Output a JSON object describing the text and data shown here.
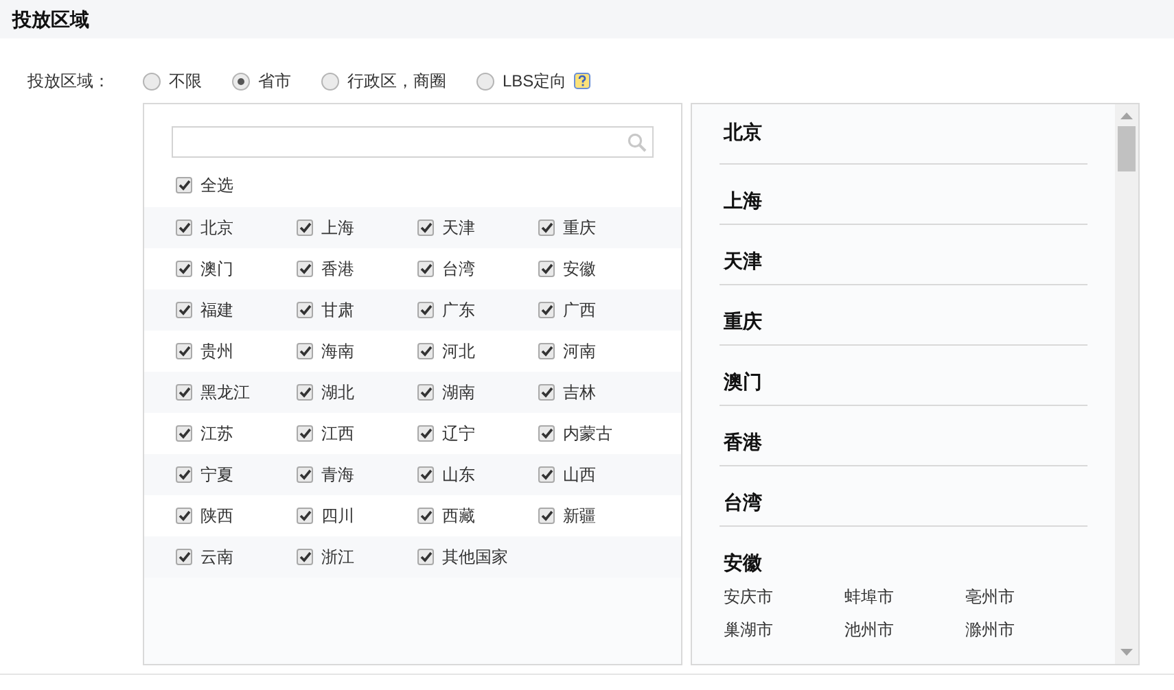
{
  "header": {
    "title": "投放区域"
  },
  "field_label": "投放区域：",
  "options": [
    {
      "label": "不限",
      "selected": false,
      "help": false
    },
    {
      "label": "省市",
      "selected": true,
      "help": false
    },
    {
      "label": "行政区，商圈",
      "selected": false,
      "help": false
    },
    {
      "label": "LBS定向",
      "selected": false,
      "help": true
    }
  ],
  "select_all": {
    "label": "全选",
    "checked": true
  },
  "regions": [
    {
      "label": "北京",
      "checked": true
    },
    {
      "label": "上海",
      "checked": true
    },
    {
      "label": "天津",
      "checked": true
    },
    {
      "label": "重庆",
      "checked": true
    },
    {
      "label": "澳门",
      "checked": true
    },
    {
      "label": "香港",
      "checked": true
    },
    {
      "label": "台湾",
      "checked": true
    },
    {
      "label": "安徽",
      "checked": true
    },
    {
      "label": "福建",
      "checked": true
    },
    {
      "label": "甘肃",
      "checked": true
    },
    {
      "label": "广东",
      "checked": true
    },
    {
      "label": "广西",
      "checked": true
    },
    {
      "label": "贵州",
      "checked": true
    },
    {
      "label": "海南",
      "checked": true
    },
    {
      "label": "河北",
      "checked": true
    },
    {
      "label": "河南",
      "checked": true
    },
    {
      "label": "黑龙江",
      "checked": true
    },
    {
      "label": "湖北",
      "checked": true
    },
    {
      "label": "湖南",
      "checked": true
    },
    {
      "label": "吉林",
      "checked": true
    },
    {
      "label": "江苏",
      "checked": true
    },
    {
      "label": "江西",
      "checked": true
    },
    {
      "label": "辽宁",
      "checked": true
    },
    {
      "label": "内蒙古",
      "checked": true
    },
    {
      "label": "宁夏",
      "checked": true
    },
    {
      "label": "青海",
      "checked": true
    },
    {
      "label": "山东",
      "checked": true
    },
    {
      "label": "山西",
      "checked": true
    },
    {
      "label": "陕西",
      "checked": true
    },
    {
      "label": "四川",
      "checked": true
    },
    {
      "label": "西藏",
      "checked": true
    },
    {
      "label": "新疆",
      "checked": true
    },
    {
      "label": "云南",
      "checked": true
    },
    {
      "label": "浙江",
      "checked": true
    },
    {
      "label": "其他国家",
      "checked": true
    }
  ],
  "selected_list": [
    {
      "name": "北京"
    },
    {
      "name": "上海"
    },
    {
      "name": "天津"
    },
    {
      "name": "重庆"
    },
    {
      "name": "澳门"
    },
    {
      "name": "香港"
    },
    {
      "name": "台湾"
    },
    {
      "name": "安徽",
      "cities": [
        "安庆市",
        "蚌埠市",
        "亳州市",
        "巢湖市",
        "池州市",
        "滁州市"
      ]
    }
  ]
}
